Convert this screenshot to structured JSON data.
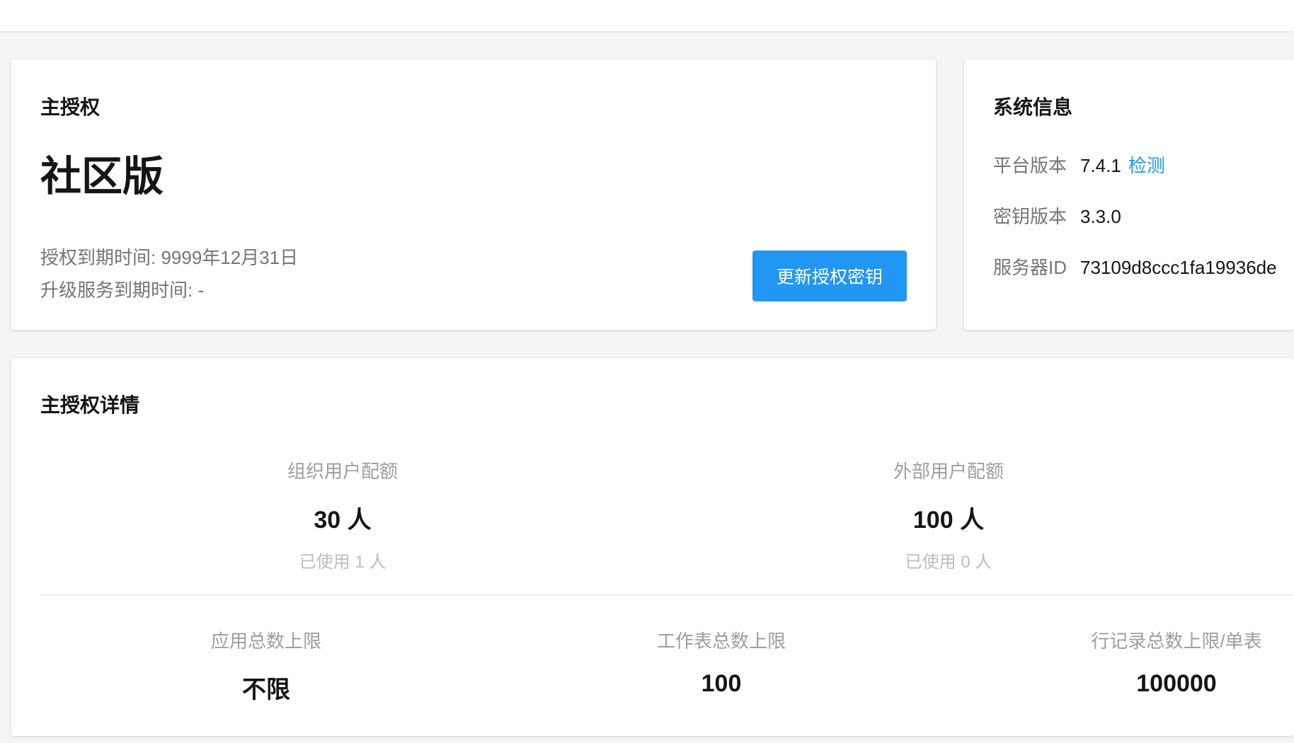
{
  "main_license": {
    "title": "主授权",
    "edition": "社区版",
    "expire_line": "授权到期时间: 9999年12月31日",
    "upgrade_line": "升级服务到期时间: -",
    "update_button": "更新授权密钥"
  },
  "system_info": {
    "title": "系统信息",
    "rows": [
      {
        "label": "平台版本",
        "value": "7.4.1",
        "link": "检测"
      },
      {
        "label": "密钥版本",
        "value": "3.3.0"
      },
      {
        "label": "服务器ID",
        "value": "73109d8ccc1fa19936de"
      }
    ]
  },
  "details": {
    "title": "主授权详情",
    "quotas": [
      {
        "label": "组织用户配额",
        "value": "30 人",
        "used": "已使用 1 人"
      },
      {
        "label": "外部用户配额",
        "value": "100 人",
        "used": "已使用 0 人"
      }
    ],
    "limits": [
      {
        "label": "应用总数上限",
        "value": "不限"
      },
      {
        "label": "工作表总数上限",
        "value": "100"
      },
      {
        "label": "行记录总数上限/单表",
        "value": "100000"
      }
    ]
  },
  "colors": {
    "primary": "#2196f3",
    "text": "#151515",
    "secondary_text": "#757575",
    "muted_text": "#bdbdbd",
    "background": "#f5f5f5"
  }
}
